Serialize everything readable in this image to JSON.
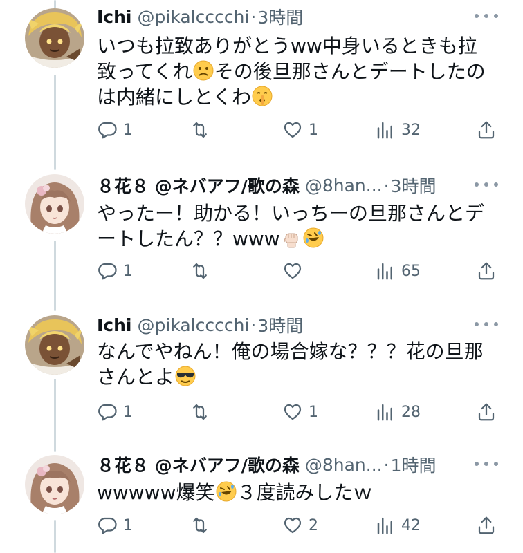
{
  "tweets": [
    {
      "name": "Ichi",
      "handle": "@pikalcccchi",
      "dot": "·",
      "time": "3時間",
      "avatar_icon": "blonde-character-avatar",
      "lines": [
        "いつも拉致ありがとうww中身いるときも拉",
        "致ってくれ",
        "その後旦那さんとデートしたの",
        "は内緒にしとくわ"
      ],
      "replies": "1",
      "retweets": "",
      "likes": "1",
      "views": "32"
    },
    {
      "name": "８花８ @ネバアフ/歌の森",
      "handle": "@8han...",
      "dot": "·",
      "time": "3時間",
      "avatar_icon": "brown-hair-girl-avatar",
      "lines": [
        "やったー！助かる！いっちーの旦那さんとデ",
        "ートしたん？？www"
      ],
      "replies": "1",
      "retweets": "",
      "likes": "",
      "views": "65"
    },
    {
      "name": "Ichi",
      "handle": "@pikalcccchi",
      "dot": "·",
      "time": "3時間",
      "avatar_icon": "blonde-character-avatar",
      "lines": [
        "なんでやねん！俺の場合嫁な？？？花の旦那",
        "さんとよ"
      ],
      "replies": "1",
      "retweets": "",
      "likes": "1",
      "views": "28"
    },
    {
      "name": "８花８ @ネバアフ/歌の森",
      "handle": "@8han...",
      "dot": "·",
      "time": "1時間",
      "avatar_icon": "brown-hair-girl-avatar",
      "lines": [
        "wwwww爆笑",
        "３度読みしたｗ"
      ],
      "replies": "1",
      "retweets": "",
      "likes": "2",
      "views": "42"
    }
  ],
  "colors": {
    "text": "#0f1419",
    "secondary": "#536471",
    "thread_line": "#cfd9de"
  },
  "icons": {
    "reply": "reply-icon",
    "retweet": "retweet-icon",
    "like": "heart-icon",
    "views": "views-chart-icon",
    "share": "share-icon",
    "more": "more-dots-icon"
  }
}
